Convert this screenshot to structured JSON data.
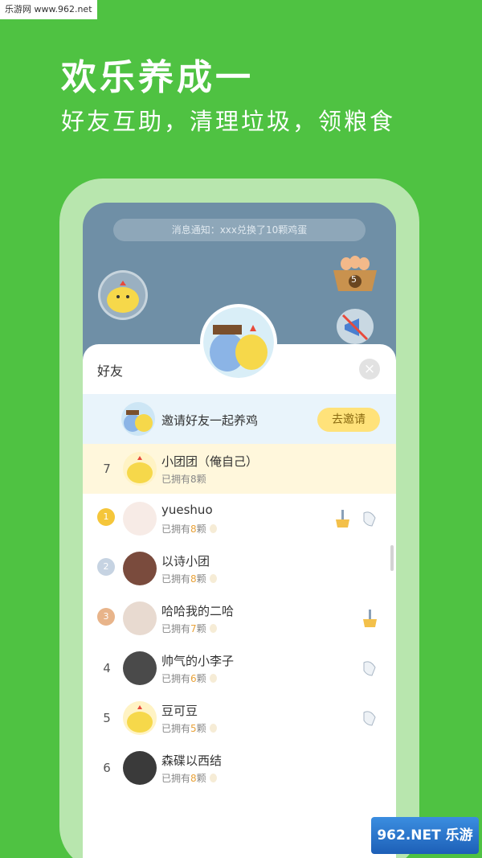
{
  "watermark_top": "乐游网 www.962.net",
  "headline": "欢乐养成一",
  "subline": "好友互助，清理垃圾，领粮食",
  "notification": "消息通知：xxx兑换了10颗鸡蛋",
  "egg_basket_count": "5",
  "sheet": {
    "title": "好友",
    "close_label": "×",
    "invite_text": "邀请好友一起养鸡",
    "invite_button": "去邀请"
  },
  "rows": [
    {
      "rank": "7",
      "name": "小团团（俺自己）",
      "owns_prefix": "已拥有",
      "count": "8",
      "owns_suffix": "颗"
    },
    {
      "rank": "1",
      "name": "yueshuo",
      "owns_prefix": "已拥有",
      "count": "8",
      "owns_suffix": "颗"
    },
    {
      "rank": "2",
      "name": "以诗小团",
      "owns_prefix": "已拥有",
      "count": "8",
      "owns_suffix": "颗"
    },
    {
      "rank": "3",
      "name": "哈哈我的二哈",
      "owns_prefix": "已拥有",
      "count": "7",
      "owns_suffix": "颗"
    },
    {
      "rank": "4",
      "name": "帅气的小李子",
      "owns_prefix": "已拥有",
      "count": "6",
      "owns_suffix": "颗"
    },
    {
      "rank": "5",
      "name": "豆可豆",
      "owns_prefix": "已拥有",
      "count": "5",
      "owns_suffix": "颗"
    },
    {
      "rank": "6",
      "name": "森碟以西结",
      "owns_prefix": "已拥有",
      "count": "8",
      "owns_suffix": "颗"
    }
  ],
  "watermark_bottom": "962.NET 乐游网",
  "colors": {
    "background": "#4fc242",
    "accent_button": "#ffe27a",
    "count_text": "#e8a23a"
  }
}
